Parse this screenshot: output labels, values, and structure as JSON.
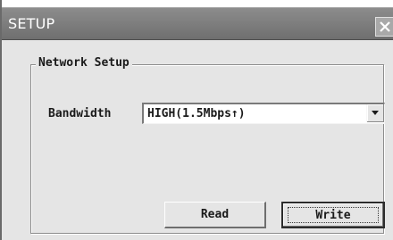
{
  "window": {
    "title": "SETUP",
    "close_icon": "close-icon"
  },
  "network_setup": {
    "group_label": "Network Setup",
    "bandwidth_label": "Bandwidth",
    "bandwidth_value": "HIGH(1.5Mbps↑)",
    "dropdown_icon": "chevron-down-icon"
  },
  "buttons": {
    "read_label": "Read",
    "write_label": "Write"
  },
  "colors": {
    "titlebar": "#7f7f7f",
    "window_bg": "#e5e5e5",
    "title_text": "#ffffff"
  }
}
